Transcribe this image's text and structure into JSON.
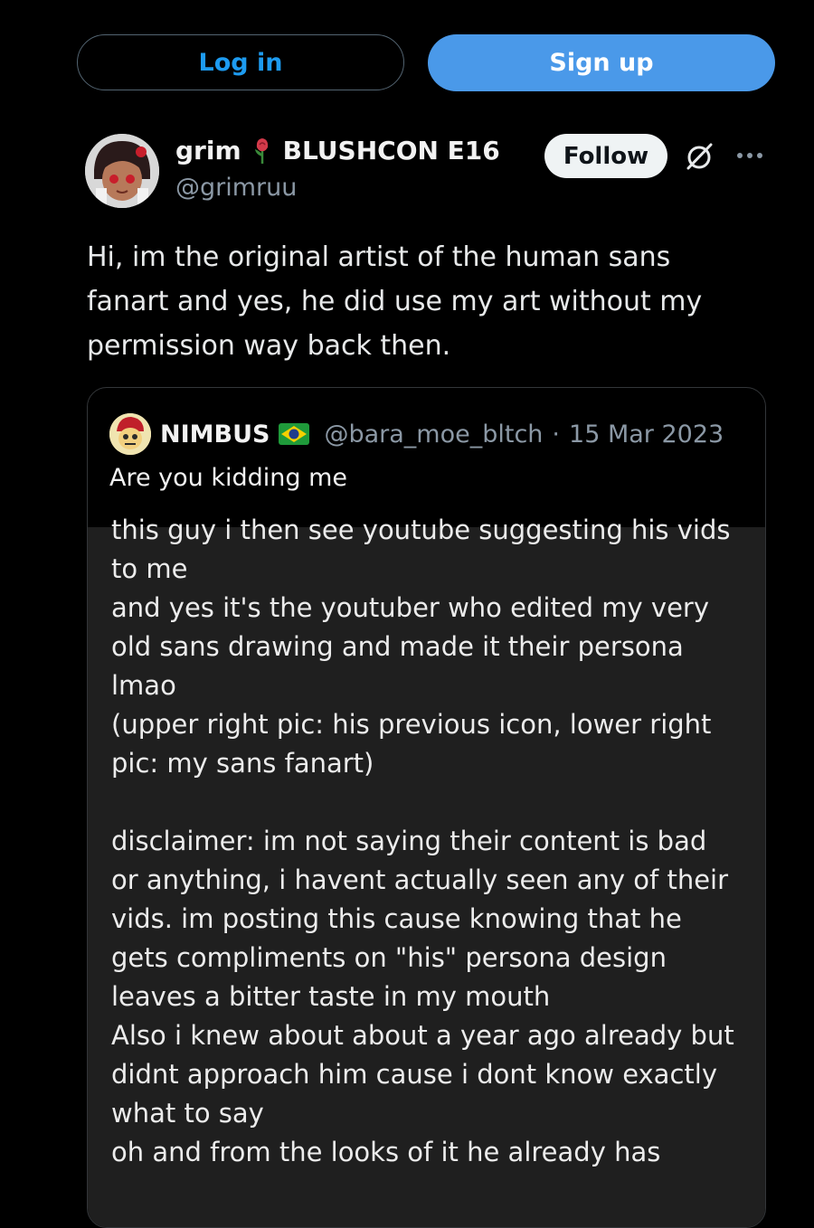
{
  "auth": {
    "login_label": "Log in",
    "signup_label": "Sign up"
  },
  "post": {
    "author_name": "grim",
    "author_name_suffix": "BLUSHCON E16",
    "handle": "@grimruu",
    "follow_label": "Follow",
    "text": "Hi, im the original artist of the human sans fanart and yes, he did use my art without my permission way back then."
  },
  "quote": {
    "author_name": "NIMBUS",
    "handle": "@bara_moe_bltch",
    "date": "15 Mar 2023",
    "separator": "·",
    "text": "Are you kidding me",
    "embedded_text": "this guy i then see youtube suggesting his vids\nto me\nand yes it's the youtuber who edited my very\nold sans drawing and made it their persona\nlmao\n(upper right pic: his previous icon, lower right\npic: my sans fanart)\n\ndisclaimer: im not saying their content is bad\nor anything, i havent actually seen any of their\nvids. im posting this cause knowing that he\ngets compliments on \"his\" persona design\nleaves a bitter taste in my mouth\nAlso i knew about about a year ago already but\ndidnt approach him cause i dont know exactly\nwhat to say\noh and from the looks of it he already has"
  },
  "icons": [
    "rose-icon",
    "brazil-flag-icon",
    "grok-icon",
    "more-icon"
  ],
  "colors": {
    "accent": "#1d9bf0",
    "signup_bg": "#4a99e9",
    "background": "#000000",
    "muted": "#8b98a5"
  }
}
